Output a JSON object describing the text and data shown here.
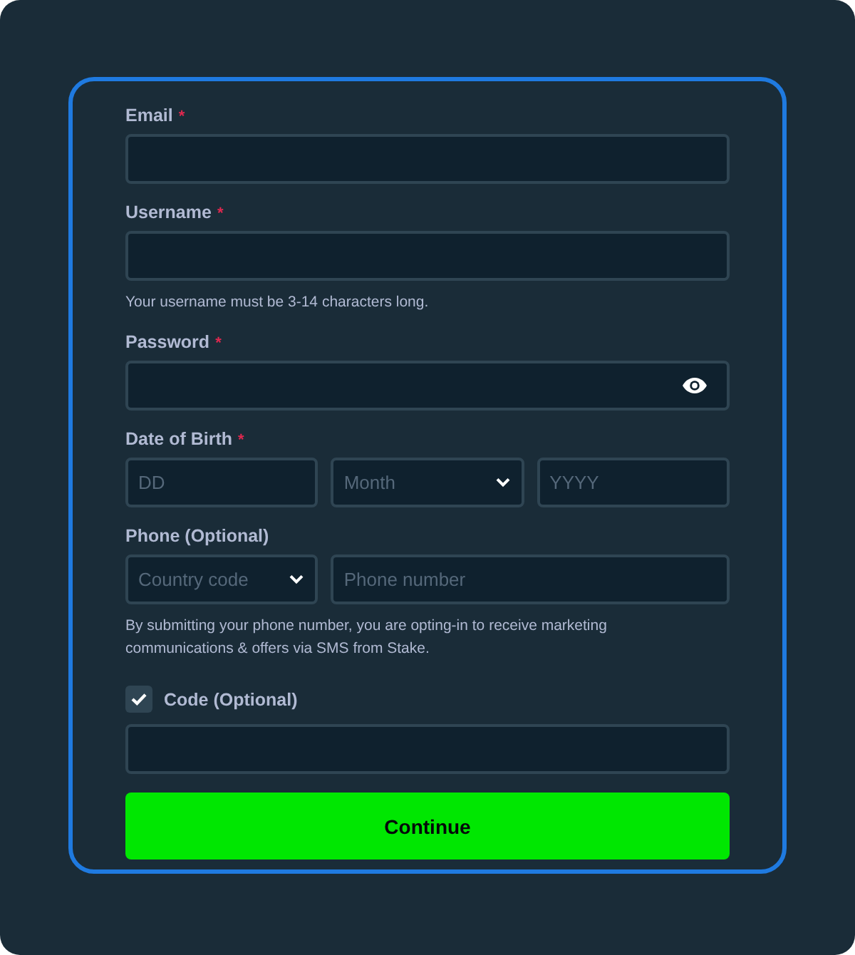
{
  "fields": [
    {
      "kind": "text",
      "label": "Email",
      "required_mark": "*"
    },
    {
      "kind": "text",
      "label": "Username",
      "required_mark": "*",
      "hint": "Your username must be 3-14 characters long."
    },
    {
      "kind": "password",
      "label": "Password",
      "required_mark": "*"
    },
    {
      "kind": "group",
      "label": "Date of Birth",
      "required_mark": "*",
      "parts": [
        {
          "kind": "input",
          "placeholder": "DD"
        },
        {
          "kind": "select",
          "placeholder": "Month"
        },
        {
          "kind": "input",
          "placeholder": "YYYY"
        }
      ]
    },
    {
      "kind": "group",
      "label": "Phone (Optional)",
      "parts": [
        {
          "kind": "select",
          "placeholder": "Country code"
        },
        {
          "kind": "input",
          "placeholder": "Phone number"
        }
      ],
      "hint": "By submitting your phone number, you are opting-in to receive marketing communications & offers via SMS from Stake."
    }
  ],
  "code": {
    "label": "Code (Optional)",
    "checked": true
  },
  "button": "Continue"
}
